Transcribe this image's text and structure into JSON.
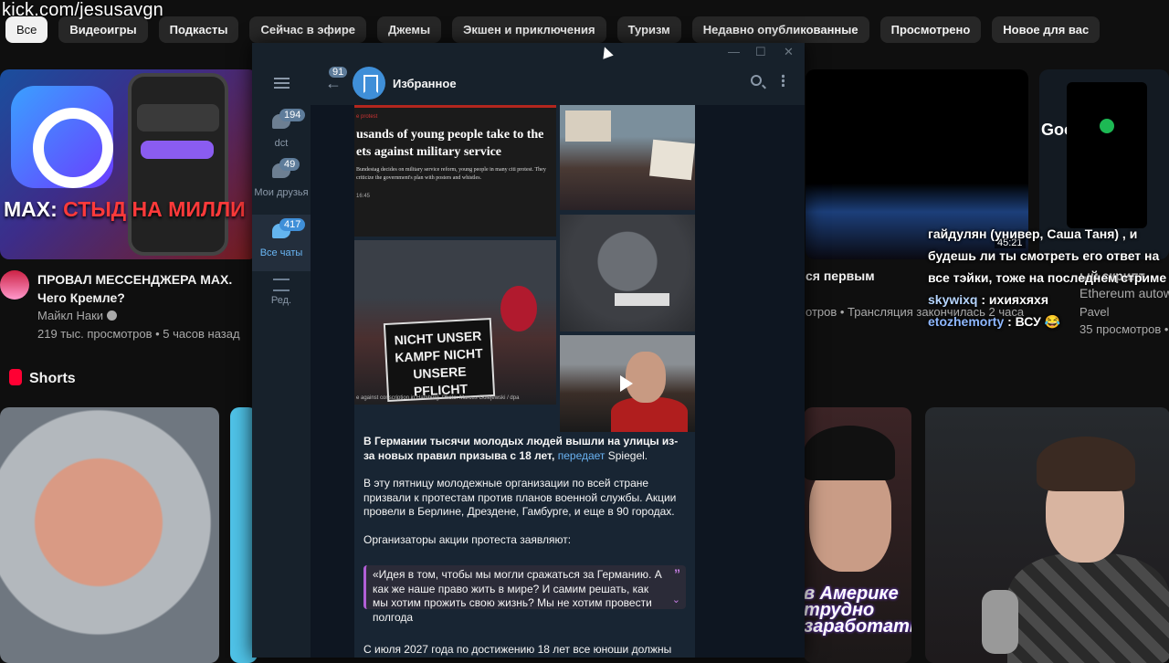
{
  "watermark": "kick.com/jesusavgn",
  "chips": [
    "Все",
    "Видеоигры",
    "Подкасты",
    "Сейчас в эфире",
    "Джемы",
    "Экшен и приключения",
    "Туризм",
    "Недавно опубликованные",
    "Просмотрено",
    "Новое для вас"
  ],
  "video1": {
    "caption_a": "MAX: ",
    "caption_b": "СТЫД НА МИЛЛИ",
    "title": "ПРОВАЛ МЕССЕНДЖЕРА MAX. Чего Кремле?",
    "channel": "Майкл Наки",
    "meta": "219 тыс. просмотров • 5 часов назад"
  },
  "video_right": {
    "title": "ся первым",
    "meta": "отров • Трансляция закончилась 2 часа",
    "duration": "45:21"
  },
  "video_far_right": {
    "title": "ый скрипт",
    "subtitle": "Ethereum autow",
    "channel": "Pavel",
    "meta": "35 просмотров • 1"
  },
  "thumb4_text": "Goog",
  "stream_chat": [
    {
      "user": "",
      "text": "гайдулян (универ, Саша Таня) , и будешь ли ты смотреть его ответ на все тэйки, тоже на последнем стриме"
    },
    {
      "user": "skywixq",
      "text": " : ихияхяхя"
    },
    {
      "user": "etozhemorty",
      "text": " : ВСУ 😂"
    }
  ],
  "shorts": {
    "label": "Shorts",
    "right1_caption": "в Америке трудно заработать"
  },
  "telegram": {
    "chat_title": "Избранное",
    "back_badge": "91",
    "folders": [
      {
        "label": "dct",
        "badge": "194"
      },
      {
        "label": "Мои друзья",
        "badge": "49"
      },
      {
        "label": "Все чаты",
        "badge": "417"
      },
      {
        "label": "Ред.",
        "badge": ""
      }
    ],
    "article": {
      "tag": "e protest",
      "headline": "usands of young people take to the ets against military service",
      "lede": "Bundestag decides on military service reform, young people in many citi protest. They criticize the government's plan with posters and whistles.",
      "time": "16:45",
      "credit": "e against conscription in Hamburg. Photo: Marcus Golejewski / dpa"
    },
    "placard": "NICHT UNSER KAMPF NICHT UNSERE PFLICHT",
    "message": {
      "bold_lead": "В Германии тысячи молодых людей вышли на улицы из-за новых правил призыва с 18 лет,",
      "link": "передает",
      "source": " Spiegel.",
      "p2": "В эту пятницу молодежные организации по всей стране призвали к протестам против планов военной службы. Акции провели в Берлине, Дрездене, Гамбурге, и еще в 90 городах.",
      "p3": "Организаторы акции протеста заявляют:",
      "quote": "«Идея в том, чтобы мы могли сражаться за Германию. А как же наше право жить в мире? И самим решать, как мы хотим прожить свою жизнь? Мы не хотим провести полгода",
      "last_line": "С июля 2027 года по достижению 18 лет все юноши должны"
    },
    "accent": "#3f8fd8"
  }
}
